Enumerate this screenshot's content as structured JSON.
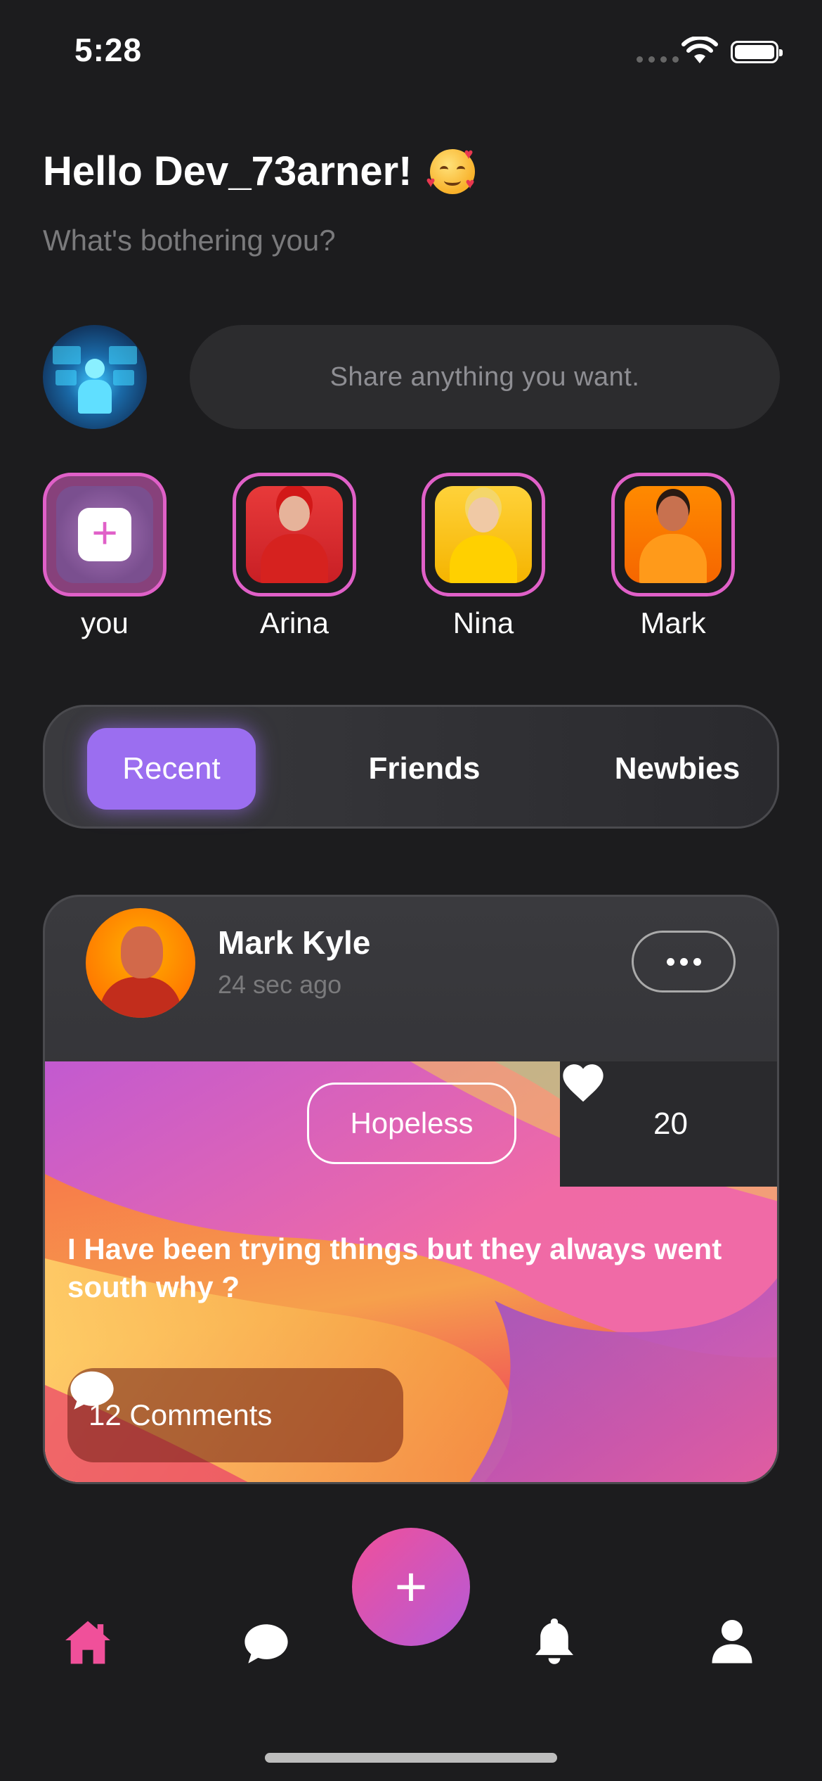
{
  "status_bar": {
    "time": "5:28"
  },
  "greeting": {
    "title": "Hello Dev_73arner!",
    "subtitle": "What's bothering you?"
  },
  "share": {
    "placeholder": "Share anything you want."
  },
  "stories": [
    {
      "name": "you"
    },
    {
      "name": "Arina"
    },
    {
      "name": "Nina"
    },
    {
      "name": "Mark"
    }
  ],
  "tabs": {
    "recent": "Recent",
    "friends": "Friends",
    "newbies": "Newbies",
    "active": "Recent"
  },
  "post": {
    "author": "Mark Kyle",
    "time": "24 sec ago",
    "mood": "Hopeless",
    "likes": "20",
    "text": "I Have been trying things  but they  always went south why ?",
    "comments": "12 Comments"
  },
  "colors": {
    "accent_pink": "#f0509a",
    "accent_purple": "#9b6ef0",
    "story_ring": "#e060c8",
    "background": "#1c1c1e"
  },
  "nav": {
    "items": [
      "home-icon",
      "chat-icon",
      "add-icon",
      "bell-icon",
      "profile-icon"
    ],
    "active": "home-icon"
  }
}
